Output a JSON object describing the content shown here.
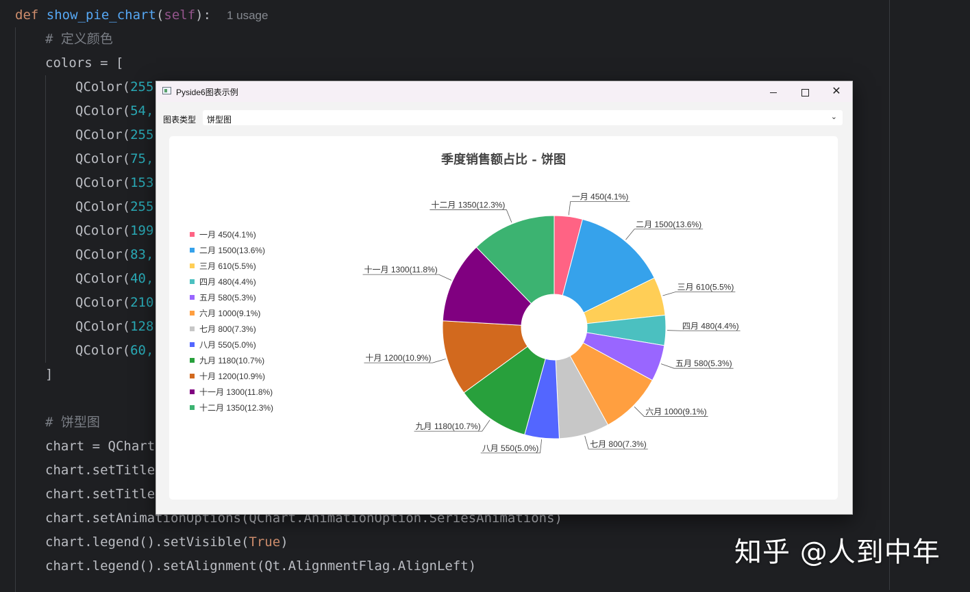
{
  "editor": {
    "line1": {
      "def_kw": "def",
      "fn_name": "show_pie_chart",
      "open": "(",
      "self_kw": "self",
      "close": "):",
      "usage_hint": "1 usage"
    },
    "comment_colors": "# 定义颜色",
    "colors_assign": "colors = [",
    "color_rows": [
      {
        "prefix": "QColor(",
        "num": "255,"
      },
      {
        "prefix": "QColor(",
        "num": "54,"
      },
      {
        "prefix": "QColor(",
        "num": "255,"
      },
      {
        "prefix": "QColor(",
        "num": "75,"
      },
      {
        "prefix": "QColor(",
        "num": "153,"
      },
      {
        "prefix": "QColor(",
        "num": "255,"
      },
      {
        "prefix": "QColor(",
        "num": "199,"
      },
      {
        "prefix": "QColor(",
        "num": "83,"
      },
      {
        "prefix": "QColor(",
        "num": "40,"
      },
      {
        "prefix": "QColor(",
        "num": "210,"
      },
      {
        "prefix": "QColor(",
        "num": "128,"
      },
      {
        "prefix": "QColor(",
        "num": "60,"
      }
    ],
    "bracket_close": "]",
    "comment_pie": "# 饼型图",
    "chart_qchart": "chart = QChart(",
    "chart_settitle": "chart.setTitle(",
    "chart_settitlefont": "chart.setTitleF",
    "chart_anim": "chart.setAnimationOptions(QChart.AnimationOption.SeriesAnimations)",
    "legend_visible": {
      "pre": "chart.legend().setVisible(",
      "val": "True",
      "post": ")"
    },
    "legend_align": "chart.legend().setAlignment(Qt.AlignmentFlag.AlignLeft)"
  },
  "window": {
    "title": "Pyside6图表示例",
    "minimize": "",
    "maximize": "",
    "close": "✕",
    "chart_type_label": "图表类型",
    "chart_type_value": "饼型图",
    "chevron": "⌄"
  },
  "chart_data": {
    "type": "pie",
    "donut": true,
    "title": "季度销售额占比 - 饼图",
    "legend_position": "left",
    "slices": [
      {
        "label": "一月 450(4.1%)",
        "value": 450,
        "color": "#ff6384"
      },
      {
        "label": "二月 1500(13.6%)",
        "value": 1500,
        "color": "#36a2eb"
      },
      {
        "label": "三月 610(5.5%)",
        "value": 610,
        "color": "#ffce56"
      },
      {
        "label": "四月 480(4.4%)",
        "value": 480,
        "color": "#4bc0c0"
      },
      {
        "label": "五月 580(5.3%)",
        "value": 580,
        "color": "#9966ff"
      },
      {
        "label": "六月 1000(9.1%)",
        "value": 1000,
        "color": "#ff9f40"
      },
      {
        "label": "七月 800(7.3%)",
        "value": 800,
        "color": "#c7c7c7"
      },
      {
        "label": "八月 550(5.0%)",
        "value": 550,
        "color": "#5366ff"
      },
      {
        "label": "九月 1180(10.7%)",
        "value": 1180,
        "color": "#28a03c"
      },
      {
        "label": "十月 1200(10.9%)",
        "value": 1200,
        "color": "#d2691e"
      },
      {
        "label": "十一月 1300(11.8%)",
        "value": 1300,
        "color": "#800080"
      },
      {
        "label": "十二月 1350(12.3%)",
        "value": 1350,
        "color": "#3cb371"
      }
    ]
  },
  "watermark": "知乎 @人到中年"
}
